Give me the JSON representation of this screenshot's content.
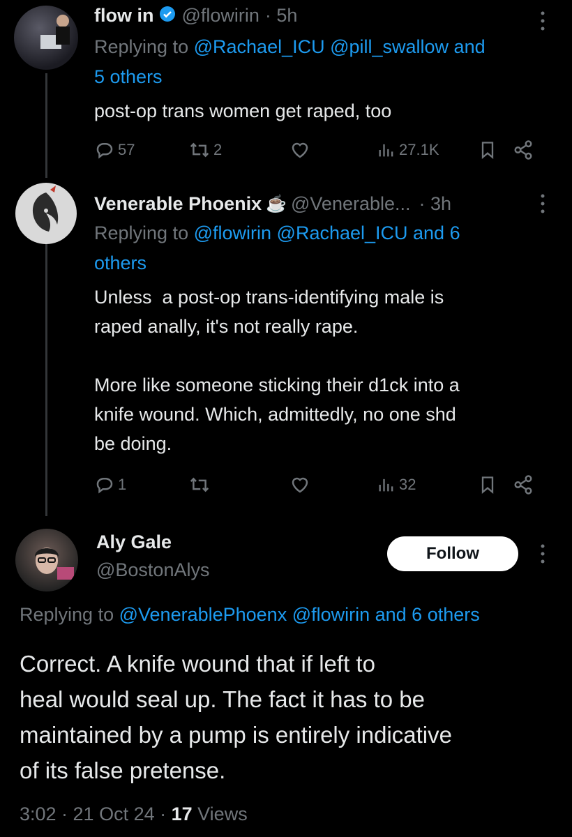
{
  "tweets": [
    {
      "name": "flow in",
      "handle": "@flowirin",
      "time": "· 5h",
      "replying_prefix": "Replying to",
      "replying_line1": "@Rachael_ICU @pill_swallow and",
      "replying_line2": "5 others",
      "body": "post-op trans women get raped, too",
      "stats": {
        "replies": "57",
        "retweets": "2",
        "likes": "",
        "views": "27.1K"
      }
    },
    {
      "name": "Venerable Phoenix",
      "emoji": "☕",
      "handle": "@Venerable...",
      "time": "· 3h",
      "replying_prefix": "Replying to",
      "replying_line1": "@flowirin @Rachael_ICU and 6",
      "replying_line2": "others",
      "body": "Unless  a post-op trans-identifying male is\nraped anally, it's not really rape.\n\nMore like someone sticking their d1ck into a\nknife wound. Which, admittedly, no one shd\nbe doing.",
      "stats": {
        "replies": "1",
        "retweets": "",
        "likes": "",
        "views": "32"
      }
    }
  ],
  "main_tweet": {
    "name": "Aly Gale",
    "handle": "@BostonAlys",
    "follow_label": "Follow",
    "replying_prefix": "Replying to",
    "replying_to": "@VenerablePhoenx @flowirin and 6 others",
    "body": "Correct. A knife wound that if left to\nheal would seal up. The fact it has to be\nmaintained by a pump is entirely indicative\nof its false pretense.",
    "timestamp": "3:02 · 21 Oct 24 · ",
    "views_count": "17",
    "views_label": " Views"
  },
  "colors": {
    "background": "#000000",
    "text": "#e7e9ea",
    "muted": "#71767b",
    "link": "#1d9bf0",
    "verified": "#1d9bf0"
  },
  "icons": [
    "verified-icon",
    "reply-icon",
    "retweet-icon",
    "like-icon",
    "views-icon",
    "bookmark-icon",
    "share-icon",
    "more-icon",
    "coffee-emoji"
  ]
}
